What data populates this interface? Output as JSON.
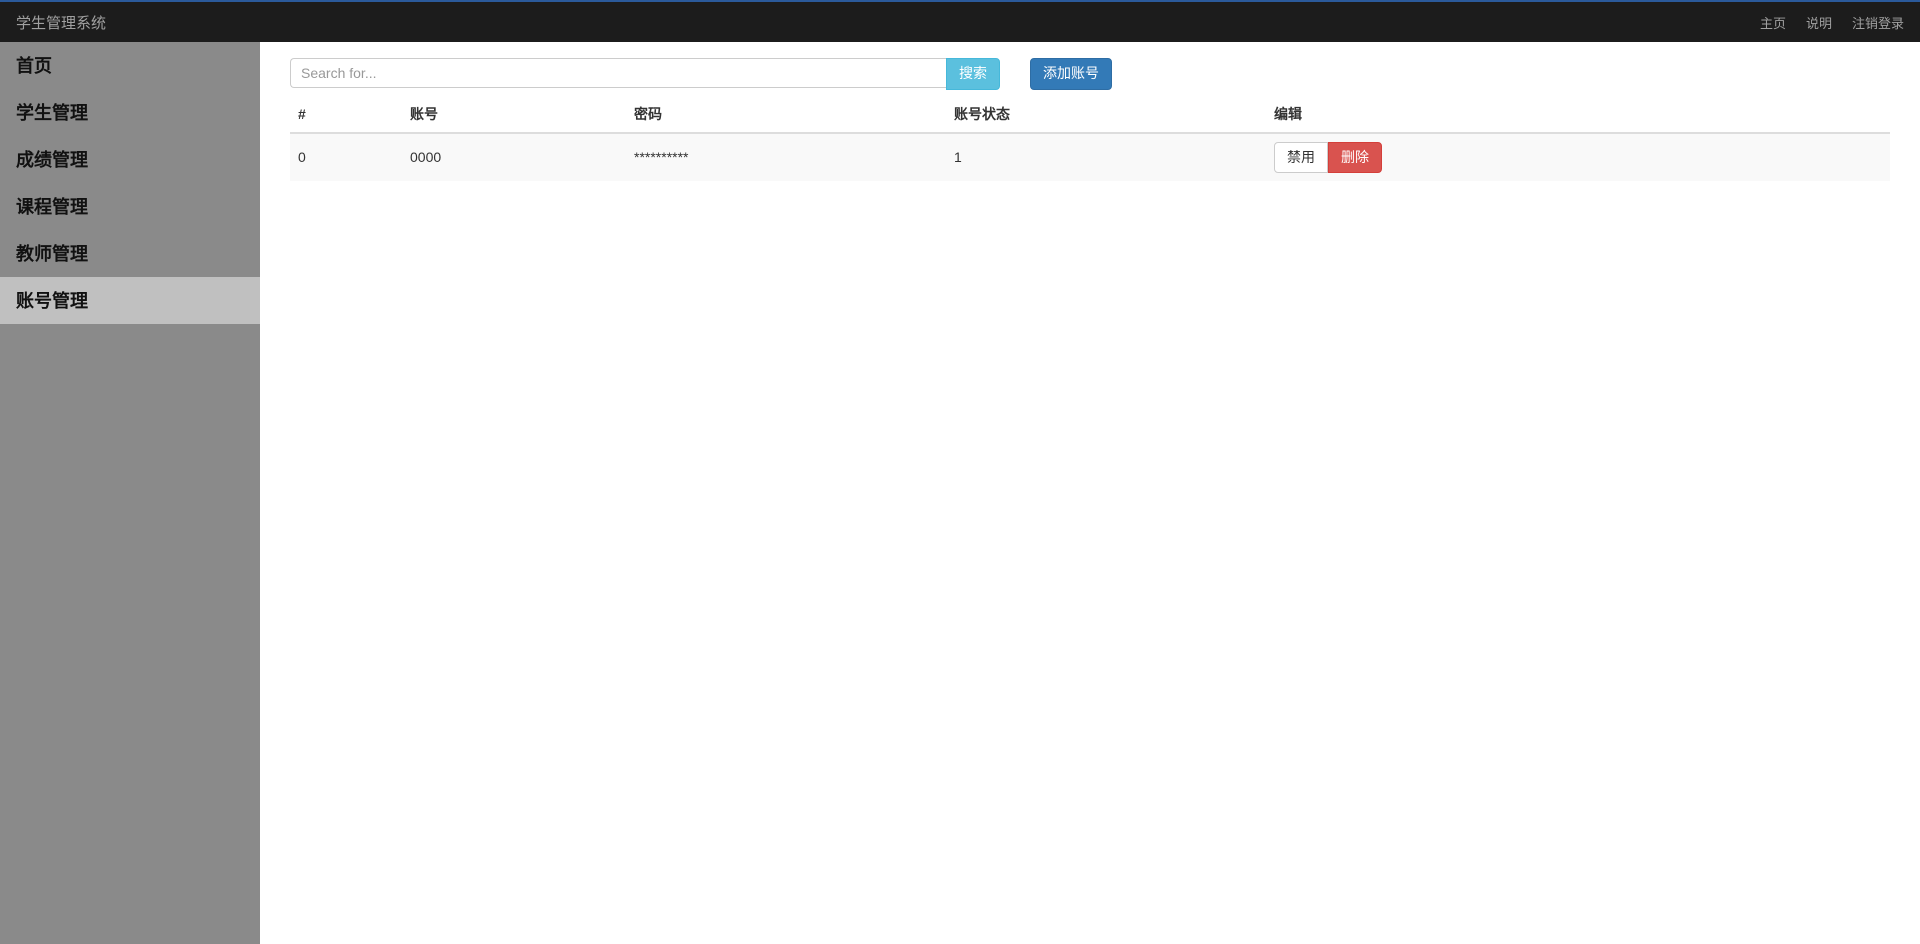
{
  "header": {
    "brand": "学生管理系统",
    "nav": {
      "home": "主页",
      "about": "说明",
      "logout": "注销登录"
    }
  },
  "sidebar": {
    "items": [
      {
        "label": "首页",
        "active": false
      },
      {
        "label": "学生管理",
        "active": false
      },
      {
        "label": "成绩管理",
        "active": false
      },
      {
        "label": "课程管理",
        "active": false
      },
      {
        "label": "教师管理",
        "active": false
      },
      {
        "label": "账号管理",
        "active": true
      }
    ]
  },
  "toolbar": {
    "search_placeholder": "Search for...",
    "search_value": "",
    "search_button": "搜索",
    "add_button": "添加账号"
  },
  "table": {
    "headers": {
      "id": "#",
      "account": "账号",
      "password": "密码",
      "status": "账号状态",
      "edit": "编辑"
    },
    "rows": [
      {
        "id": "0",
        "account": "0000",
        "password": "**********",
        "status": "1",
        "actions": {
          "disable": "禁用",
          "delete": "删除"
        }
      }
    ]
  }
}
